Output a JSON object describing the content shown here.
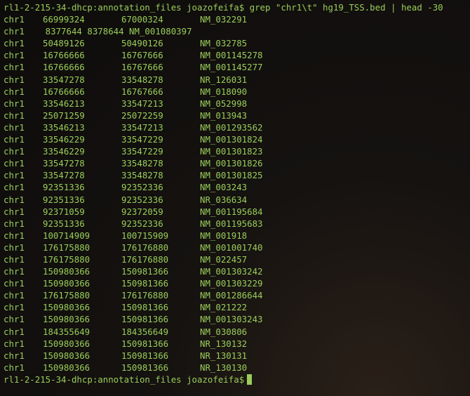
{
  "terminal": {
    "command_line": "rl1-2-215-34-dhcp:annotation_files joazofeifa$ grep \"chr1\\t\" hg19_TSS.bed | head -30",
    "special_line": "chr1    8377644 8378644 NM_001080397",
    "rows": [
      [
        "chr1",
        "66999324",
        "67000324",
        "NM_032291"
      ],
      null,
      [
        "chr1",
        "50489126",
        "50490126",
        "NM_032785"
      ],
      [
        "chr1",
        "16766666",
        "16767666",
        "NM_001145278"
      ],
      [
        "chr1",
        "16766666",
        "16767666",
        "NM_001145277"
      ],
      [
        "chr1",
        "33547278",
        "33548278",
        "NR_126031"
      ],
      [
        "chr1",
        "16766666",
        "16767666",
        "NM_018090"
      ],
      [
        "chr1",
        "33546213",
        "33547213",
        "NM_052998"
      ],
      [
        "chr1",
        "25071259",
        "25072259",
        "NM_013943"
      ],
      [
        "chr1",
        "33546213",
        "33547213",
        "NM_001293562"
      ],
      [
        "chr1",
        "33546229",
        "33547229",
        "NM_001301824"
      ],
      [
        "chr1",
        "33546229",
        "33547229",
        "NM_001301823"
      ],
      [
        "chr1",
        "33547278",
        "33548278",
        "NM_001301826"
      ],
      [
        "chr1",
        "33547278",
        "33548278",
        "NM_001301825"
      ],
      [
        "chr1",
        "92351336",
        "92352336",
        "NM_003243"
      ],
      [
        "chr1",
        "92351336",
        "92352336",
        "NR_036634"
      ],
      [
        "chr1",
        "92371059",
        "92372059",
        "NM_001195684"
      ],
      [
        "chr1",
        "92351336",
        "92352336",
        "NM_001195683"
      ],
      [
        "chr1",
        "100714909",
        "100715909",
        "NM_001918"
      ],
      [
        "chr1",
        "176175880",
        "176176880",
        "NM_001001740"
      ],
      [
        "chr1",
        "176175880",
        "176176880",
        "NM_022457"
      ],
      [
        "chr1",
        "150980366",
        "150981366",
        "NM_001303242"
      ],
      [
        "chr1",
        "150980366",
        "150981366",
        "NM_001303229"
      ],
      [
        "chr1",
        "176175880",
        "176176880",
        "NM_001286644"
      ],
      [
        "chr1",
        "150980366",
        "150981366",
        "NM_021222"
      ],
      [
        "chr1",
        "150980366",
        "150981366",
        "NM_001303243"
      ],
      [
        "chr1",
        "184355649",
        "184356649",
        "NM_030806"
      ],
      [
        "chr1",
        "150980366",
        "150981366",
        "NR_130132"
      ],
      [
        "chr1",
        "150980366",
        "150981366",
        "NR_130131"
      ],
      [
        "chr1",
        "150980366",
        "150981366",
        "NR_130130"
      ]
    ],
    "prompt": "rl1-2-215-34-dhcp:annotation_files joazofeifa$",
    "text_color": "#9acd5a",
    "background_color": "#121010"
  }
}
